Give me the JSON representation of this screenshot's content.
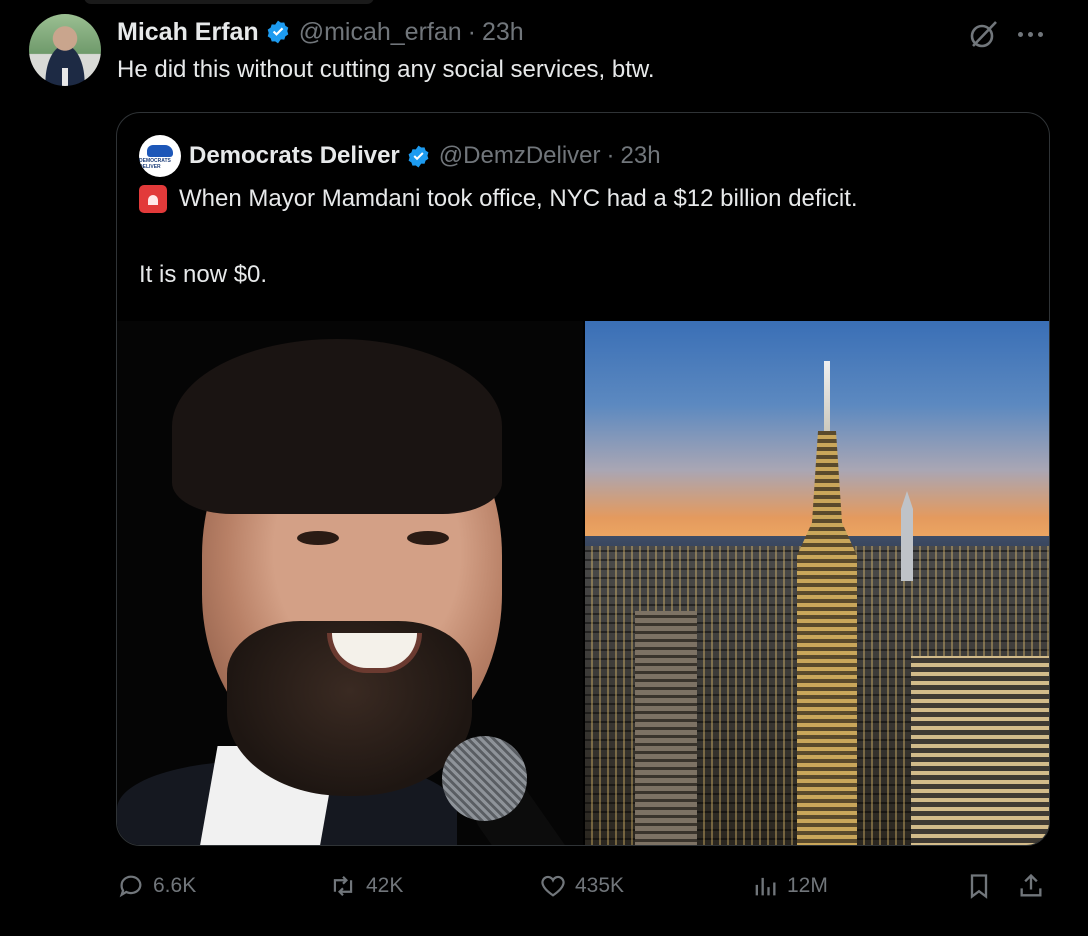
{
  "tweet": {
    "author_name": "Micah Erfan",
    "handle": "@micah_erfan",
    "separator": "·",
    "time": "23h",
    "text": "He did this without cutting any social services, btw."
  },
  "quoted_tweet": {
    "author_name": "Democrats Deliver",
    "avatar_text": "DEMOCRATS DELIVER",
    "handle": "@DemzDeliver",
    "separator": "·",
    "time": "23h",
    "line1": "When Mayor Mamdani took office, NYC had a $12 billion deficit.",
    "line2": "It is now $0."
  },
  "actions": {
    "replies": "6.6K",
    "reposts": "42K",
    "likes": "435K",
    "views": "12M"
  },
  "colors": {
    "background": "#000000",
    "text_primary": "#e7e9ea",
    "text_secondary": "#71767b",
    "verified_blue": "#1d9bf0",
    "border": "#2f3336"
  },
  "icons": [
    "verified-badge-icon",
    "grok-icon",
    "more-icon",
    "siren-emoji-icon",
    "reply-icon",
    "repost-icon",
    "like-icon",
    "views-icon",
    "bookmark-icon",
    "share-icon"
  ]
}
